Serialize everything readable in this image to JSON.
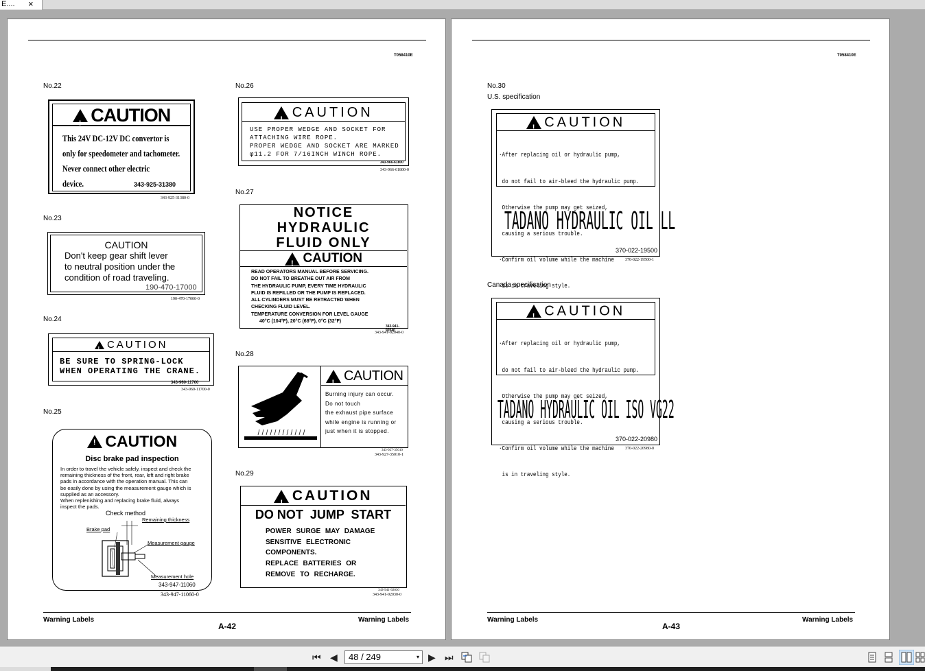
{
  "tab": {
    "title": "E....",
    "close": "×"
  },
  "left_page": {
    "doc_id": "T058410E",
    "footer_left": "Warning Labels",
    "footer_right": "Warning Labels",
    "page_number": "A-42",
    "labels": {
      "no22": {
        "number": "No.22",
        "heading": "CAUTION",
        "lines": [
          "This 24V DC-12V DC convertor is",
          "only for speedometer and tachometer.",
          "Never connect other electric",
          "device."
        ],
        "part_no": "343-925-31380",
        "ref": "343-925-31380-0"
      },
      "no23": {
        "number": "No.23",
        "heading": "CAUTION",
        "lines": [
          "Don't keep gear shift lever",
          "to neutral position under the",
          "condition of road traveling."
        ],
        "part_no": "190-470-17000",
        "ref": "190-470-17000-0"
      },
      "no24": {
        "number": "No.24",
        "heading": "CAUTION",
        "lines": [
          "BE SURE TO SPRING-LOCK",
          "WHEN OPERATING THE CRANE."
        ],
        "part_no": "343-960-11700",
        "ref": "343-960-11700-0"
      },
      "no25": {
        "number": "No.25",
        "heading": "CAUTION",
        "subheading": "Disc brake pad inspection",
        "lines": [
          "In order to travel the vehicle safely, inspect and check the",
          "remaining thickness of the front, rear, left and right brake",
          "pads in accordance with the operation manual. This can",
          "be easily done by using the measurement gauge which is",
          "supplied as an accessory.",
          "When replenishing and replacing brake fluid, always",
          "inspect the pads."
        ],
        "check_method": "Check method",
        "callouts": {
          "remaining": "Remaining thickness",
          "brake_pad": "Brake pad",
          "gauge": "Measurement gauge",
          "hole": "Measurement hole"
        },
        "part_no": "343-947-11060",
        "ref": "343-947-11060-0"
      },
      "no26": {
        "number": "No.26",
        "heading": "CAUTION",
        "lines": [
          "USE PROPER WEDGE AND SOCKET FOR",
          "ATTACHING WIRE ROPE.",
          "PROPER WEDGE AND SOCKET ARE MARKED",
          "φ11.2 FOR 7/16INCH WINCH ROPE."
        ],
        "part_no": "343-966-61800",
        "ref": "343-966-61800-0"
      },
      "no27": {
        "number": "No.27",
        "notice": [
          "NOTICE",
          "HYDRAULIC",
          "FLUID  ONLY"
        ],
        "heading": "CAUTION",
        "lines": [
          "READ OPERATORS MANUAL BEFORE SERVICING.",
          "DO NOT FAIL TO BREATHE OUT AIR FROM",
          "THE HYDRAULIC PUMP, EVERY TIME HYDRAULIC",
          "FLUID IS REFILLED OR THE PUMP IS REPLACED.",
          "ALL CYLINDERS MUST BE RETRACTED WHEN",
          "CHECKING FLUID LEVEL.",
          "TEMPERATURE CONVERSION FOR LEVEL GAUGE",
          "40°C (104°F), 20°C (68°F), 0°C (32°F)"
        ],
        "part_no": "343-941-92040",
        "ref": "343-941-92040-0"
      },
      "no28": {
        "number": "No.28",
        "heading": "CAUTION",
        "lines": [
          "Burning injury can occur.",
          "Do not touch",
          "the exhaust pipe surface",
          "while engine is running or",
          "just when it is stopped."
        ],
        "part_no": "343-927-35010",
        "ref": "343-927-35010-1"
      },
      "no29": {
        "number": "No.29",
        "heading": "CAUTION",
        "title": "DO NOT  JUMP  START",
        "lines": [
          "POWER SURGE MAY DAMAGE",
          "SENSITIVE ELECTRONIC",
          "COMPONENTS.",
          "REPLACE BATTERIES OR",
          "REMOVE TO RECHARGE."
        ],
        "part_no": "343-941-92030",
        "ref": "343-941-92030-0"
      }
    }
  },
  "right_page": {
    "doc_id": "T058410E",
    "footer_left": "Warning Labels",
    "footer_right": "Warning Labels",
    "page_number": "A-43",
    "no30": {
      "number": "No.30",
      "us_spec": "U.S. specification",
      "canada_spec": "Canada specification",
      "heading": "CAUTION",
      "lines": [
        "·After replacing oil or hydraulic pump,",
        " do not fail to air-bleed the hydraulic pump.",
        " Otherwise the pump may get seized,",
        " causing a serious trouble.",
        "·Confirm oil volume while the machine",
        " is in traveling style."
      ],
      "us_oil": "TADANO HYDRAULIC OIL LL",
      "us_part": "370-022-19500",
      "us_ref": "370-022-19500-1",
      "ca_oil": "TADANO HYDRAULIC OIL ISO VG22",
      "ca_part": "370-022-20980",
      "ca_ref": "370-022-20980-0"
    }
  },
  "toolbar": {
    "first": "⏮",
    "prev": "◀",
    "page_display": "48 / 249",
    "dropdown": "▾",
    "next": "▶",
    "last": "⏭"
  }
}
